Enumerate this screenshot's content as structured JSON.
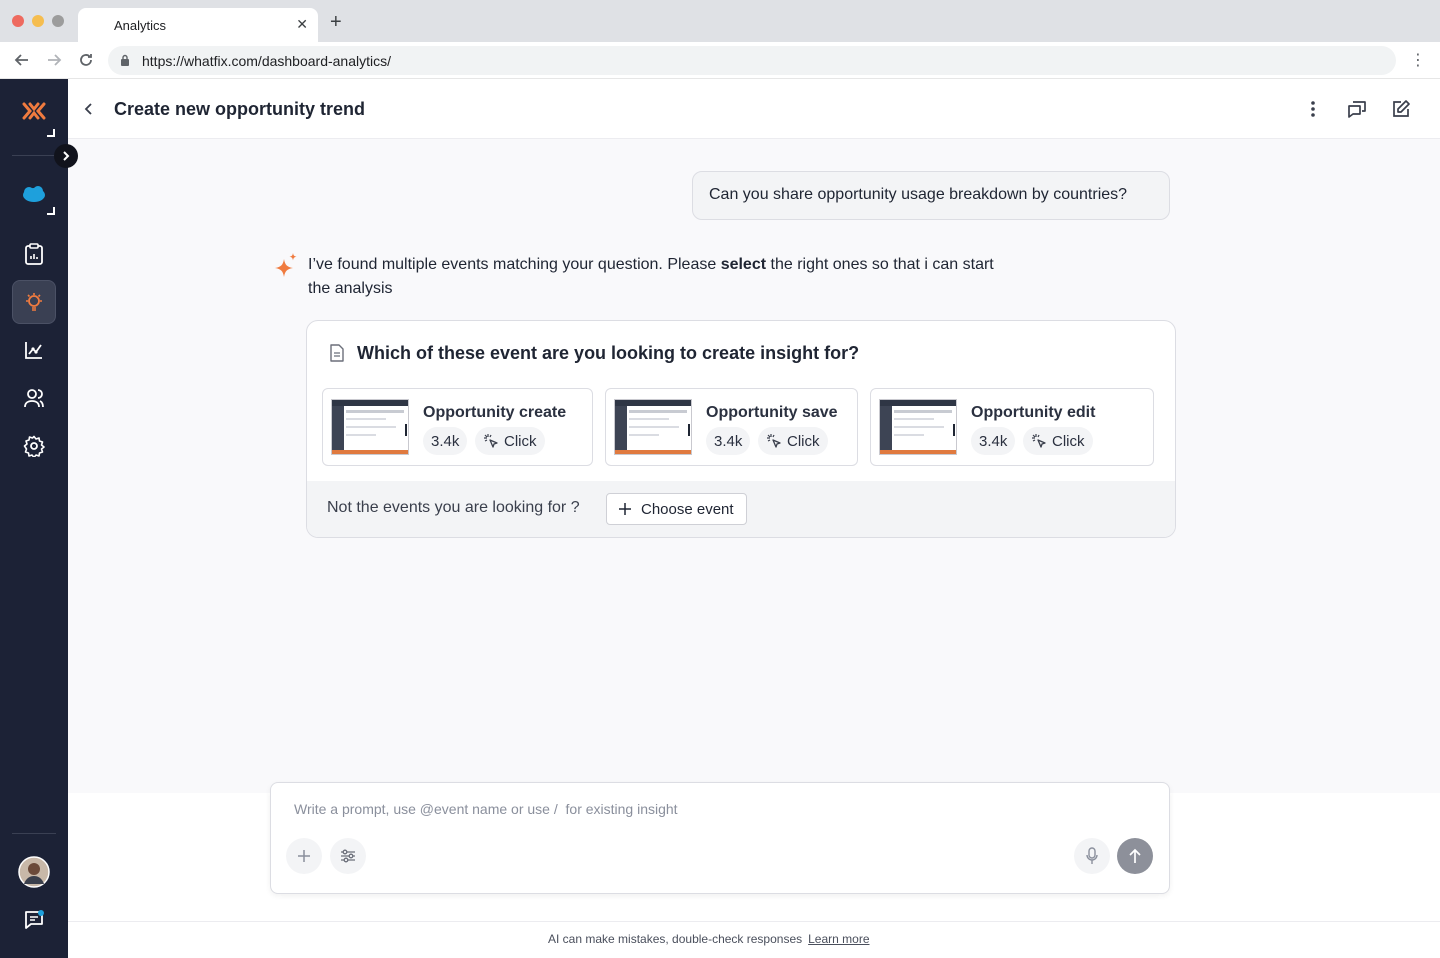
{
  "browser": {
    "tab_title": "Analytics",
    "url": "https://whatfix.com/dashboard-analytics/",
    "traffic_colors": [
      "#ee6a5f",
      "#f5bd4f",
      "#9c9c9c"
    ]
  },
  "header": {
    "title": "Create new opportunity trend"
  },
  "chat": {
    "user_message": "Can you share opportunity usage breakdown by countries?",
    "ai_message_before": "I’ve found multiple events matching your question. Please ",
    "ai_message_bold": "select",
    "ai_message_after": " the right ones so that i can start the analysis",
    "card_title": "Which of these event are you looking to create insight for?",
    "events": [
      {
        "name": "Opportunity create",
        "count": "3.4k",
        "type": "Click"
      },
      {
        "name": "Opportunity save",
        "count": "3.4k",
        "type": "Click"
      },
      {
        "name": "Opportunity edit",
        "count": "3.4k",
        "type": "Click"
      }
    ],
    "footer_text": "Not the events you are looking for ?",
    "choose_label": "Choose event"
  },
  "prompt": {
    "placeholder": "Write a prompt, use @event name or use /  for existing insight"
  },
  "footer": {
    "disclaimer": "AI can make mistakes, double-check responses",
    "learn_more": "Learn more"
  },
  "colors": {
    "sidebar": "#1c2236",
    "accent": "#f07b3f"
  }
}
